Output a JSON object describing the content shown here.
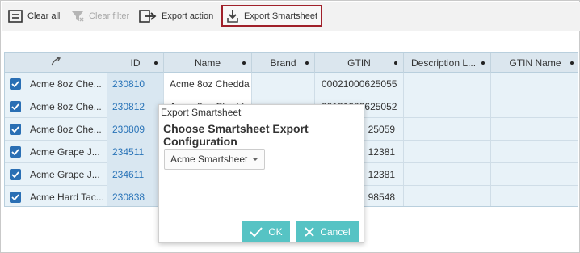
{
  "toolbar": {
    "clear_all": "Clear all",
    "clear_filter": "Clear filter",
    "export_action": "Export action",
    "export_smartsheet": "Export Smartsheet"
  },
  "grid": {
    "columns": [
      "",
      "ID",
      "Name",
      "Brand",
      "GTIN",
      "Description L...",
      "GTIN Name"
    ],
    "rows": [
      {
        "first": "Acme 8oz Che...",
        "id": "230810",
        "name": "Acme 8oz Chedda",
        "brand": "",
        "gtin": "00021000625055",
        "desc": "",
        "gtin_name": ""
      },
      {
        "first": "Acme 8oz Che...",
        "id": "230812",
        "name": "Acme 8oz Chedda",
        "brand": "",
        "gtin": "00121000625052",
        "desc": "",
        "gtin_name": ""
      },
      {
        "first": "Acme 8oz Che...",
        "id": "230809",
        "name": "",
        "brand": "",
        "gtin": "25059",
        "desc": "",
        "gtin_name": ""
      },
      {
        "first": "Acme Grape J...",
        "id": "234511",
        "name": "",
        "brand": "",
        "gtin": "12381",
        "desc": "",
        "gtin_name": ""
      },
      {
        "first": "Acme Grape J...",
        "id": "234611",
        "name": "",
        "brand": "",
        "gtin": "12381",
        "desc": "",
        "gtin_name": ""
      },
      {
        "first": "Acme Hard Tac...",
        "id": "230838",
        "name": "",
        "brand": "",
        "gtin": "98548",
        "desc": "",
        "gtin_name": ""
      }
    ]
  },
  "dialog": {
    "title": "Export Smartsheet",
    "heading": "Choose Smartsheet Export Configuration",
    "selected": "Acme Smartsheet",
    "ok_label": "OK",
    "cancel_label": "Cancel"
  },
  "colors": {
    "accent_button": "#56c3c4",
    "highlight_border": "#a0202a",
    "checkbox": "#2a6fb4",
    "link": "#2a74b8"
  }
}
